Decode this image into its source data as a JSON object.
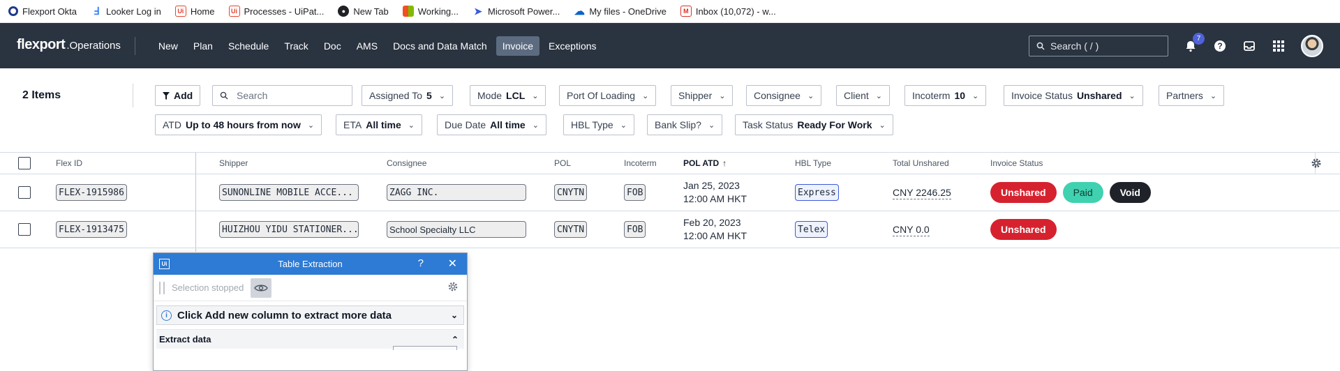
{
  "bookmarks": [
    {
      "label": "Flexport Okta",
      "icon": "okta-icon",
      "color": "#1e3a8a",
      "glyph": "O"
    },
    {
      "label": "Looker Log in",
      "icon": "looker-icon",
      "color": "#4285f4",
      "glyph": "L"
    },
    {
      "label": "Home",
      "icon": "uipath-icon",
      "color": "#e0452f",
      "glyph": "Ui"
    },
    {
      "label": "Processes - UiPat...",
      "icon": "uipath-icon",
      "color": "#e0452f",
      "glyph": "Ui"
    },
    {
      "label": "New Tab",
      "icon": "globe-icon",
      "color": "#202124",
      "glyph": "●"
    },
    {
      "label": "Working...",
      "icon": "microsoft-icon",
      "color": "#f25022",
      "glyph": "■"
    },
    {
      "label": "Microsoft Power...",
      "icon": "power-automate-icon",
      "color": "#3b5bdb",
      "glyph": "➤"
    },
    {
      "label": "My files - OneDrive",
      "icon": "onedrive-icon",
      "color": "#0a64c7",
      "glyph": "☁"
    },
    {
      "label": "Inbox (10,072) - w...",
      "icon": "gmail-icon",
      "color": "#d93025",
      "glyph": "M"
    }
  ],
  "nav": {
    "brand": "flexport",
    "brand_sub": ".Operations",
    "items": [
      "New",
      "Plan",
      "Schedule",
      "Track",
      "Doc",
      "AMS",
      "Docs and Data Match",
      "Invoice",
      "Exceptions"
    ],
    "active": "Invoice",
    "search_placeholder": "Search ( / )",
    "notification_count": "7"
  },
  "filters": {
    "items_count": "2 Items",
    "add_label": "Add",
    "search_placeholder": "Search",
    "assigned_to": {
      "label": "Assigned To",
      "value": "5"
    },
    "mode": {
      "label": "Mode",
      "value": "LCL"
    },
    "port_of_loading": {
      "label": "Port Of Loading"
    },
    "shipper": {
      "label": "Shipper"
    },
    "consignee": {
      "label": "Consignee"
    },
    "client": {
      "label": "Client"
    },
    "incoterm": {
      "label": "Incoterm",
      "value": "10"
    },
    "invoice_status": {
      "label": "Invoice Status",
      "value": "Unshared"
    },
    "partners": {
      "label": "Partners"
    },
    "atd": {
      "label": "ATD",
      "value": "Up to 48 hours from now"
    },
    "eta": {
      "label": "ETA",
      "value": "All time"
    },
    "due_date": {
      "label": "Due Date",
      "value": "All time"
    },
    "hbl_type": {
      "label": "HBL Type"
    },
    "bank_slip": {
      "label": "Bank Slip?"
    },
    "task_status": {
      "label": "Task Status",
      "value": "Ready For Work"
    }
  },
  "table": {
    "headers": {
      "flex_id": "Flex ID",
      "shipper": "Shipper",
      "consignee": "Consignee",
      "pol": "POL",
      "incoterm": "Incoterm",
      "pol_atd": "POL ATD",
      "hbl_type": "HBL Type",
      "total_unshared": "Total Unshared",
      "invoice_status": "Invoice Status"
    },
    "rows": [
      {
        "flex_id": "FLEX-1915986",
        "shipper": "SUNONLINE MOBILE ACCE...",
        "consignee": "ZAGG INC.",
        "pol": "CNYTN",
        "incoterm": "FOB",
        "atd_date": "Jan 25, 2023",
        "atd_time": "12:00 AM HKT",
        "hbl_type": "Express",
        "total": "CNY 2246.25",
        "status_unshared": "Unshared",
        "status_paid": "Paid",
        "status_void": "Void"
      },
      {
        "flex_id": "FLEX-1913475",
        "shipper": "HUIZHOU YIDU STATIONER...",
        "consignee": "School Specialty LLC",
        "pol": "CNYTN",
        "incoterm": "FOB",
        "atd_date": "Feb 20, 2023",
        "atd_time": "12:00 AM HKT",
        "hbl_type": "Telex",
        "total": "CNY 0.0",
        "status_unshared": "Unshared"
      }
    ]
  },
  "panel": {
    "title": "Table Extraction",
    "help": "?",
    "status": "Selection stopped",
    "info": "Click Add new column to extract more data",
    "section": "Extract data"
  },
  "colors": {
    "nav_bg": "#2a3340",
    "active_tab": "#5c6b80",
    "unshared": "#d6222e",
    "paid": "#40d1b0",
    "void": "#1f2329",
    "panel_header": "#2d7bd4"
  }
}
